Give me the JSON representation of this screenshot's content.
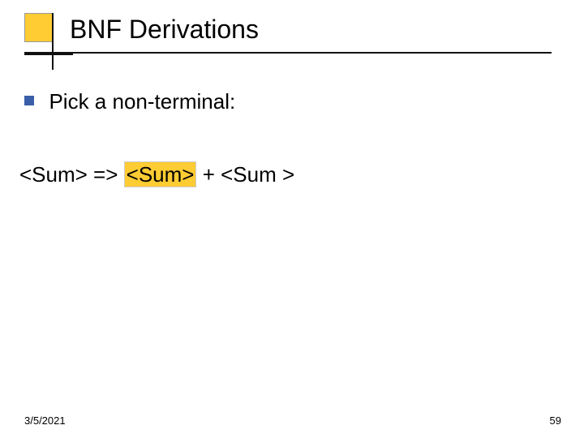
{
  "title": "BNF Derivations",
  "bullet": "Pick a non-terminal:",
  "deriv": {
    "lhs": "<Sum> =>",
    "hl": "<Sum>",
    "rhs": " + <Sum >"
  },
  "footer": {
    "date": "3/5/2021",
    "page": "59"
  }
}
